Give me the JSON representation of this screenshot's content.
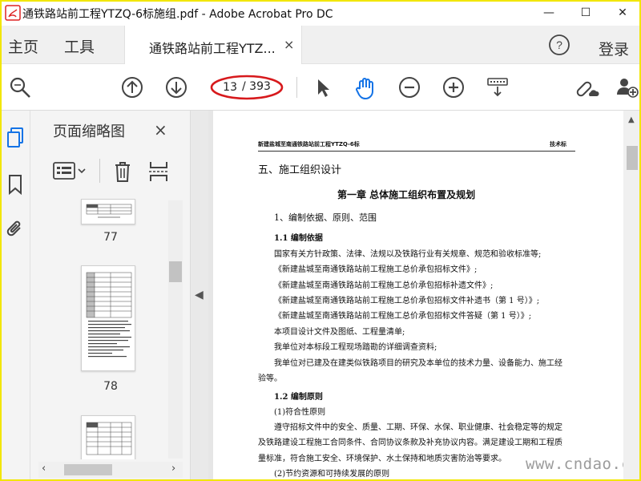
{
  "window": {
    "title": "通铁路站前工程YTZQ-6标施组.pdf - Adobe Acrobat Pro DC",
    "controls": {
      "minimize": "—",
      "maximize": "☐",
      "close": "✕"
    }
  },
  "nav": {
    "home_label": "主页",
    "tools_label": "工具",
    "doc_tab_label": "通铁路站前工程YTZ...",
    "doc_tab_close": "×",
    "help_label": "?",
    "login_label": "登录"
  },
  "toolbar": {
    "current_page": "13",
    "total_pages": "/ 393",
    "icons": [
      "zoom-search-icon",
      "page-up-icon",
      "page-down-icon",
      "select-arrow-icon",
      "hand-icon",
      "zoom-out-icon",
      "zoom-in-icon",
      "scroll-mode-icon",
      "link-cloud-icon",
      "add-user-icon"
    ]
  },
  "thumbnails_panel": {
    "title": "页面缩略图",
    "close": "×",
    "pages": [
      {
        "number": "77"
      },
      {
        "number": "78"
      },
      {
        "number": ""
      }
    ]
  },
  "document": {
    "header_left": "新建盐城至南通铁路站前工程YTZQ-6标",
    "header_right": "技术标",
    "lines": [
      {
        "text": "五、施工组织设计",
        "style": "h1"
      },
      {
        "text": "第一章   总体施工组织布置及规划",
        "style": "h2"
      },
      {
        "text": "1、编制依据、原则、范围",
        "style": "h3"
      },
      {
        "text": "1.1  编制依据",
        "style": "h4"
      },
      {
        "text": "国家有关方针政策、法律、法规以及铁路行业有关规章、规范和验收标准等;",
        "style": "body"
      },
      {
        "text": "《新建盐城至南通铁路站前工程施工总价承包招标文件》;",
        "style": "body"
      },
      {
        "text": "《新建盐城至南通铁路站前工程施工总价承包招标补遗文件》;",
        "style": "body"
      },
      {
        "text": "《新建盐城至南通铁路站前工程施工总价承包招标文件补遗书（第 1 号）》;",
        "style": "body"
      },
      {
        "text": "《新建盐城至南通铁路站前工程施工总价承包招标文件答疑（第 1 号）》;",
        "style": "body"
      },
      {
        "text": "本项目设计文件及图纸、工程量清单;",
        "style": "body"
      },
      {
        "text": "我单位对本标段工程现场踏勘的详细调查资料;",
        "style": "body"
      },
      {
        "text": "我单位对已建及在建类似铁路项目的研究及本单位的技术力量、设备能力、施工经",
        "style": "body"
      },
      {
        "text": "验等。",
        "style": "body-cont"
      },
      {
        "text": "1.2  编制原则",
        "style": "h4"
      },
      {
        "text": "(1)符合性原则",
        "style": "body"
      },
      {
        "text": "遵守招标文件中的安全、质量、工期、环保、水保、职业健康、社会稳定等的规定",
        "style": "body"
      },
      {
        "text": "及铁路建设工程施工合同条件、合同协议条款及补充协议内容。满足建设工期和工程质",
        "style": "body-cont"
      },
      {
        "text": "量标准，符合施工安全、环境保护、水土保持和地质灾害防治等要求。",
        "style": "body-cont"
      },
      {
        "text": "(2)节约资源和可持续发展的原则",
        "style": "body"
      }
    ]
  },
  "watermark": "www.cndao.com",
  "colors": {
    "accent": "#1473e6",
    "annotation": "#d7191c",
    "frame": "#f2e600"
  }
}
